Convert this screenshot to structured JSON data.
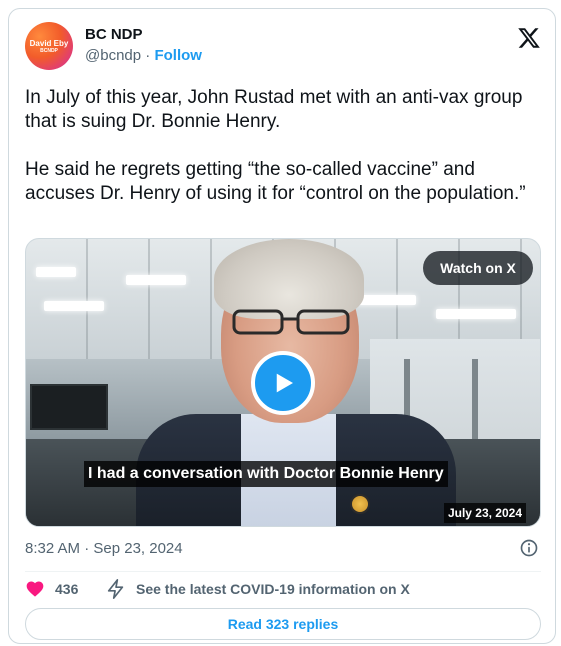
{
  "author": {
    "name": "BC NDP",
    "handle": "@bcndp",
    "separator": "·",
    "follow_label": "Follow",
    "avatar_text": "David Eby",
    "avatar_subtext": "BCNDP"
  },
  "tweet": {
    "text": "In July of this year, John Rustad met with an anti-vax group that is suing Dr. Bonnie Henry.\n\nHe said he regrets getting “the so-called vaccine” and accuses Dr. Henry of using it for “control on the population.”"
  },
  "media": {
    "watch_label": "Watch on X",
    "caption": "I had a conversation with Doctor Bonnie Henry",
    "video_date": "July 23, 2024"
  },
  "meta": {
    "timestamp": "8:32 AM · Sep 23, 2024"
  },
  "actions": {
    "like_count": "436",
    "covid_link": "See the latest COVID-19 information on X"
  },
  "footer": {
    "read_replies": "Read 323 replies"
  },
  "colors": {
    "accent": "#1d9bf0",
    "like": "#f91880",
    "text": "#0f1419",
    "muted": "#536471",
    "border": "#cfd9de"
  },
  "icons": [
    "x-logo-icon",
    "play-icon",
    "info-icon",
    "heart-icon",
    "lightning-bolt-icon"
  ]
}
